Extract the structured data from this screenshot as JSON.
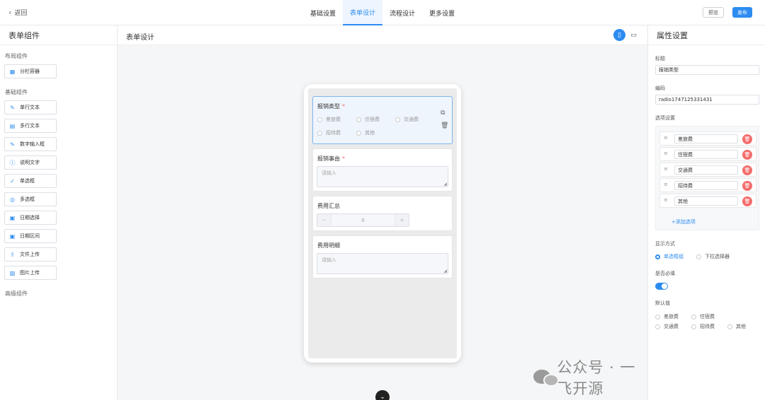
{
  "topbar": {
    "back_label": "返回",
    "tabs": [
      {
        "label": "基础设置",
        "active": false
      },
      {
        "label": "表单设计",
        "active": true
      },
      {
        "label": "流程设计",
        "active": false
      },
      {
        "label": "更多设置",
        "active": false
      }
    ],
    "preview_label": "预览",
    "publish_label": "发布"
  },
  "left": {
    "title": "表单组件",
    "layout_group": "布局组件",
    "layout_items": [
      {
        "label": "分栏容器",
        "icon": "grid-icon"
      }
    ],
    "basic_group": "基础组件",
    "basic_items": [
      {
        "label": "单行文本",
        "icon": "pen-icon"
      },
      {
        "label": "多行文本",
        "icon": "document-icon"
      },
      {
        "label": "数字输入框",
        "icon": "pen-icon"
      },
      {
        "label": "说明文字",
        "icon": "info-icon"
      },
      {
        "label": "单选框",
        "icon": "check-icon"
      },
      {
        "label": "多选框",
        "icon": "check-circle-icon"
      },
      {
        "label": "日期选择",
        "icon": "calendar-icon"
      },
      {
        "label": "日期区间",
        "icon": "calendar-icon"
      },
      {
        "label": "文件上传",
        "icon": "upload-icon"
      },
      {
        "label": "图片上传",
        "icon": "image-icon"
      }
    ],
    "advanced_group": "高级组件"
  },
  "center": {
    "title": "表单设计",
    "fields": {
      "type": {
        "label": "报销类型",
        "required": "*",
        "options": [
          "差旅费",
          "住宿费",
          "交通费",
          "招待费",
          "其他"
        ]
      },
      "reason": {
        "label": "报销事由",
        "required": "*",
        "placeholder": "请输入"
      },
      "total": {
        "label": "费用汇总",
        "value": "0",
        "minus": "−",
        "plus": "+"
      },
      "detail": {
        "label": "费用明细",
        "placeholder": "请输入"
      }
    }
  },
  "watermark": {
    "text": "公众号 · 一飞开源"
  },
  "right": {
    "title": "属性设置",
    "title_label": "标题",
    "title_value": "报销类型",
    "code_label": "编码",
    "code_value": "radio1747125331431",
    "options_label": "选项设置",
    "options": [
      "差旅费",
      "住宿费",
      "交通费",
      "招待费",
      "其他"
    ],
    "add_option": "+添加选项",
    "display_label": "显示方式",
    "display_options": [
      {
        "label": "单选框组",
        "selected": true
      },
      {
        "label": "下拉选择器",
        "selected": false
      }
    ],
    "required_label": "是否必填",
    "required_on": true,
    "default_label": "默认值",
    "default_options": [
      "差旅费",
      "住宿费",
      "交通费",
      "招待费",
      "其他"
    ]
  },
  "colors": {
    "accent": "#2d8cf0",
    "danger": "#f56c6c",
    "selected_bg": "#eef5fc"
  }
}
